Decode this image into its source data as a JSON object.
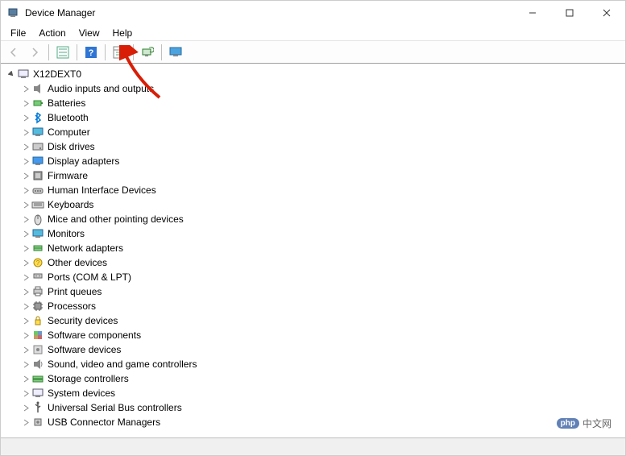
{
  "window": {
    "title": "Device Manager"
  },
  "menu": {
    "items": [
      "File",
      "Action",
      "View",
      "Help"
    ]
  },
  "toolbar": {
    "buttons": [
      {
        "name": "back-button",
        "icon": "arrow-left-icon",
        "disabled": true
      },
      {
        "name": "forward-button",
        "icon": "arrow-right-icon",
        "disabled": true
      },
      {
        "sep": true
      },
      {
        "name": "show-hide-tree-button",
        "icon": "tree-icon",
        "disabled": false
      },
      {
        "sep": true
      },
      {
        "name": "help-button",
        "icon": "help-icon",
        "disabled": false
      },
      {
        "sep": true
      },
      {
        "name": "properties-button",
        "icon": "properties-icon",
        "disabled": false
      },
      {
        "sep": true
      },
      {
        "name": "scan-hardware-button",
        "icon": "scan-icon",
        "disabled": false
      },
      {
        "sep": true
      },
      {
        "name": "devices-and-printers-button",
        "icon": "monitor-icon",
        "disabled": false
      }
    ]
  },
  "tree": {
    "root": {
      "label": "X12DEXT0",
      "expanded": true,
      "icon": "computer-root-icon"
    },
    "categories": [
      {
        "label": "Audio inputs and outputs",
        "icon": "audio-icon"
      },
      {
        "label": "Batteries",
        "icon": "battery-icon"
      },
      {
        "label": "Bluetooth",
        "icon": "bluetooth-icon"
      },
      {
        "label": "Computer",
        "icon": "computer-icon"
      },
      {
        "label": "Disk drives",
        "icon": "disk-icon"
      },
      {
        "label": "Display adapters",
        "icon": "display-icon"
      },
      {
        "label": "Firmware",
        "icon": "firmware-icon"
      },
      {
        "label": "Human Interface Devices",
        "icon": "hid-icon"
      },
      {
        "label": "Keyboards",
        "icon": "keyboard-icon"
      },
      {
        "label": "Mice and other pointing devices",
        "icon": "mouse-icon"
      },
      {
        "label": "Monitors",
        "icon": "monitor-device-icon"
      },
      {
        "label": "Network adapters",
        "icon": "network-icon"
      },
      {
        "label": "Other devices",
        "icon": "other-icon"
      },
      {
        "label": "Ports (COM & LPT)",
        "icon": "port-icon"
      },
      {
        "label": "Print queues",
        "icon": "printer-icon"
      },
      {
        "label": "Processors",
        "icon": "processor-icon"
      },
      {
        "label": "Security devices",
        "icon": "security-icon"
      },
      {
        "label": "Software components",
        "icon": "software-component-icon"
      },
      {
        "label": "Software devices",
        "icon": "software-device-icon"
      },
      {
        "label": "Sound, video and game controllers",
        "icon": "sound-icon"
      },
      {
        "label": "Storage controllers",
        "icon": "storage-icon"
      },
      {
        "label": "System devices",
        "icon": "system-icon"
      },
      {
        "label": "Universal Serial Bus controllers",
        "icon": "usb-icon"
      },
      {
        "label": "USB Connector Managers",
        "icon": "usb-connector-icon"
      }
    ]
  },
  "watermark": {
    "badge": "php",
    "text": "中文网"
  },
  "colors": {
    "annotation": "#d81e06",
    "bluetooth": "#0078d7",
    "help_bg": "#2e75d4"
  }
}
